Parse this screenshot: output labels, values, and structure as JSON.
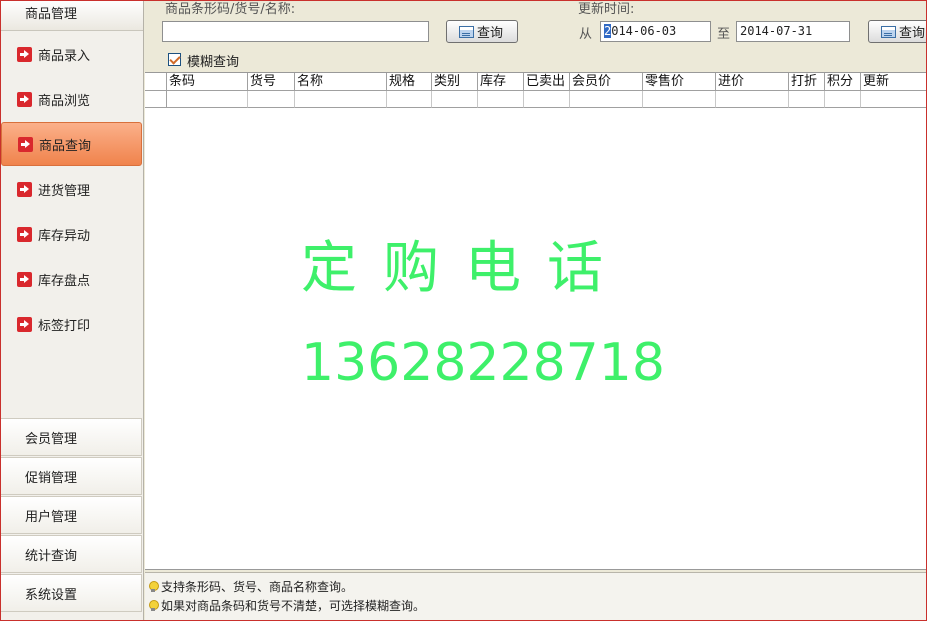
{
  "sidebar": {
    "header": "商品管理",
    "items": [
      {
        "label": "商品录入"
      },
      {
        "label": "商品浏览"
      },
      {
        "label": "商品查询"
      },
      {
        "label": "进货管理"
      },
      {
        "label": "库存异动"
      },
      {
        "label": "库存盘点"
      },
      {
        "label": "标签打印"
      }
    ],
    "active_index": 2,
    "bottom": [
      {
        "label": "会员管理"
      },
      {
        "label": "促销管理"
      },
      {
        "label": "用户管理"
      },
      {
        "label": "统计查询"
      },
      {
        "label": "系统设置"
      }
    ]
  },
  "search": {
    "keyword_label": "商品条形码/货号/名称:",
    "keyword_value": "",
    "query_button": "查询",
    "fuzzy_label": "模糊查询",
    "fuzzy_checked": true
  },
  "date_filter": {
    "label": "更新时间:",
    "from_label": "从",
    "from_first": "2",
    "from_rest": "014-06-03",
    "to_label": "至",
    "to_value": "2014-07-31",
    "query_button": "查询"
  },
  "grid": {
    "columns": [
      "条码",
      "货号",
      "名称",
      "规格",
      "类别",
      "库存",
      "已卖出",
      "会员价",
      "零售价",
      "进价",
      "打折",
      "积分",
      "更新"
    ]
  },
  "watermark": {
    "title": "定购电话",
    "phone": "13628228718"
  },
  "hints": [
    "支持条形码、货号、商品名称查询。",
    "如果对商品条码和货号不清楚，可选择模糊查询。"
  ],
  "colors": {
    "accent_active": "#f0834c",
    "watermark": "#3ef06a",
    "frame": "#c9302c"
  }
}
